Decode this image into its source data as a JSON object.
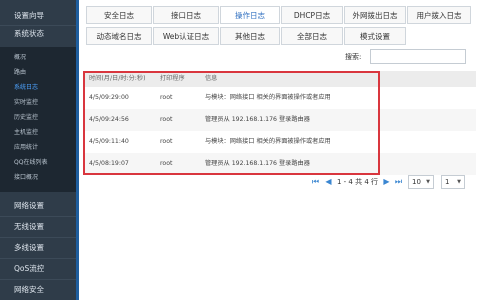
{
  "sidebar": {
    "top_items": [
      "设置向导",
      "系统状态"
    ],
    "sub_items": [
      {
        "label": "概况",
        "active": false
      },
      {
        "label": "路由",
        "active": false
      },
      {
        "label": "系统日志",
        "active": true
      },
      {
        "label": "实时监控",
        "active": false
      },
      {
        "label": "历史监控",
        "active": false
      },
      {
        "label": "主机监控",
        "active": false
      },
      {
        "label": "应用统计",
        "active": false
      },
      {
        "label": "QQ在线列表",
        "active": false
      },
      {
        "label": "接口概况",
        "active": false
      }
    ],
    "bottom_items": [
      "网络设置",
      "无线设置",
      "多线设置",
      "QoS流控",
      "网络安全"
    ]
  },
  "tabs_row1": [
    {
      "label": "安全日志",
      "active": false
    },
    {
      "label": "接口日志",
      "active": false
    },
    {
      "label": "操作日志",
      "active": true
    },
    {
      "label": "DHCP日志",
      "active": false
    },
    {
      "label": "外网拨出日志",
      "active": false
    },
    {
      "label": "用户拨入日志",
      "active": false
    }
  ],
  "tabs_row2": [
    {
      "label": "动态域名日志",
      "active": false
    },
    {
      "label": "Web认证日志",
      "active": false
    },
    {
      "label": "其他日志",
      "active": false
    },
    {
      "label": "全部日志",
      "active": false
    },
    {
      "label": "模式设置",
      "active": false
    }
  ],
  "search": {
    "label": "搜索:",
    "value": ""
  },
  "table": {
    "headers": [
      "时间(月/日/时:分:秒)",
      "打印程序",
      "信息"
    ],
    "rows": [
      {
        "time": "4/5/09:29:00",
        "program": "root",
        "info": "与模块：网络接口 相关的界面被操作或者应用"
      },
      {
        "time": "4/5/09:24:56",
        "program": "root",
        "info": "管理员从 192.168.1.176 登录路由器"
      },
      {
        "time": "4/5/09:11:40",
        "program": "root",
        "info": "与模块：网络接口 相关的界面被操作或者应用"
      },
      {
        "time": "4/5/08:19:07",
        "program": "root",
        "info": "管理员从 192.168.1.176 登录路由器"
      }
    ]
  },
  "pagination": {
    "info": "1 - 4 共 4 行",
    "page_size": "10",
    "page": "1"
  },
  "colors": {
    "sidebar": "#2f3c49",
    "accent": "#1f5e9e",
    "highlight": "#d9363e",
    "link": "#3a86d1"
  }
}
